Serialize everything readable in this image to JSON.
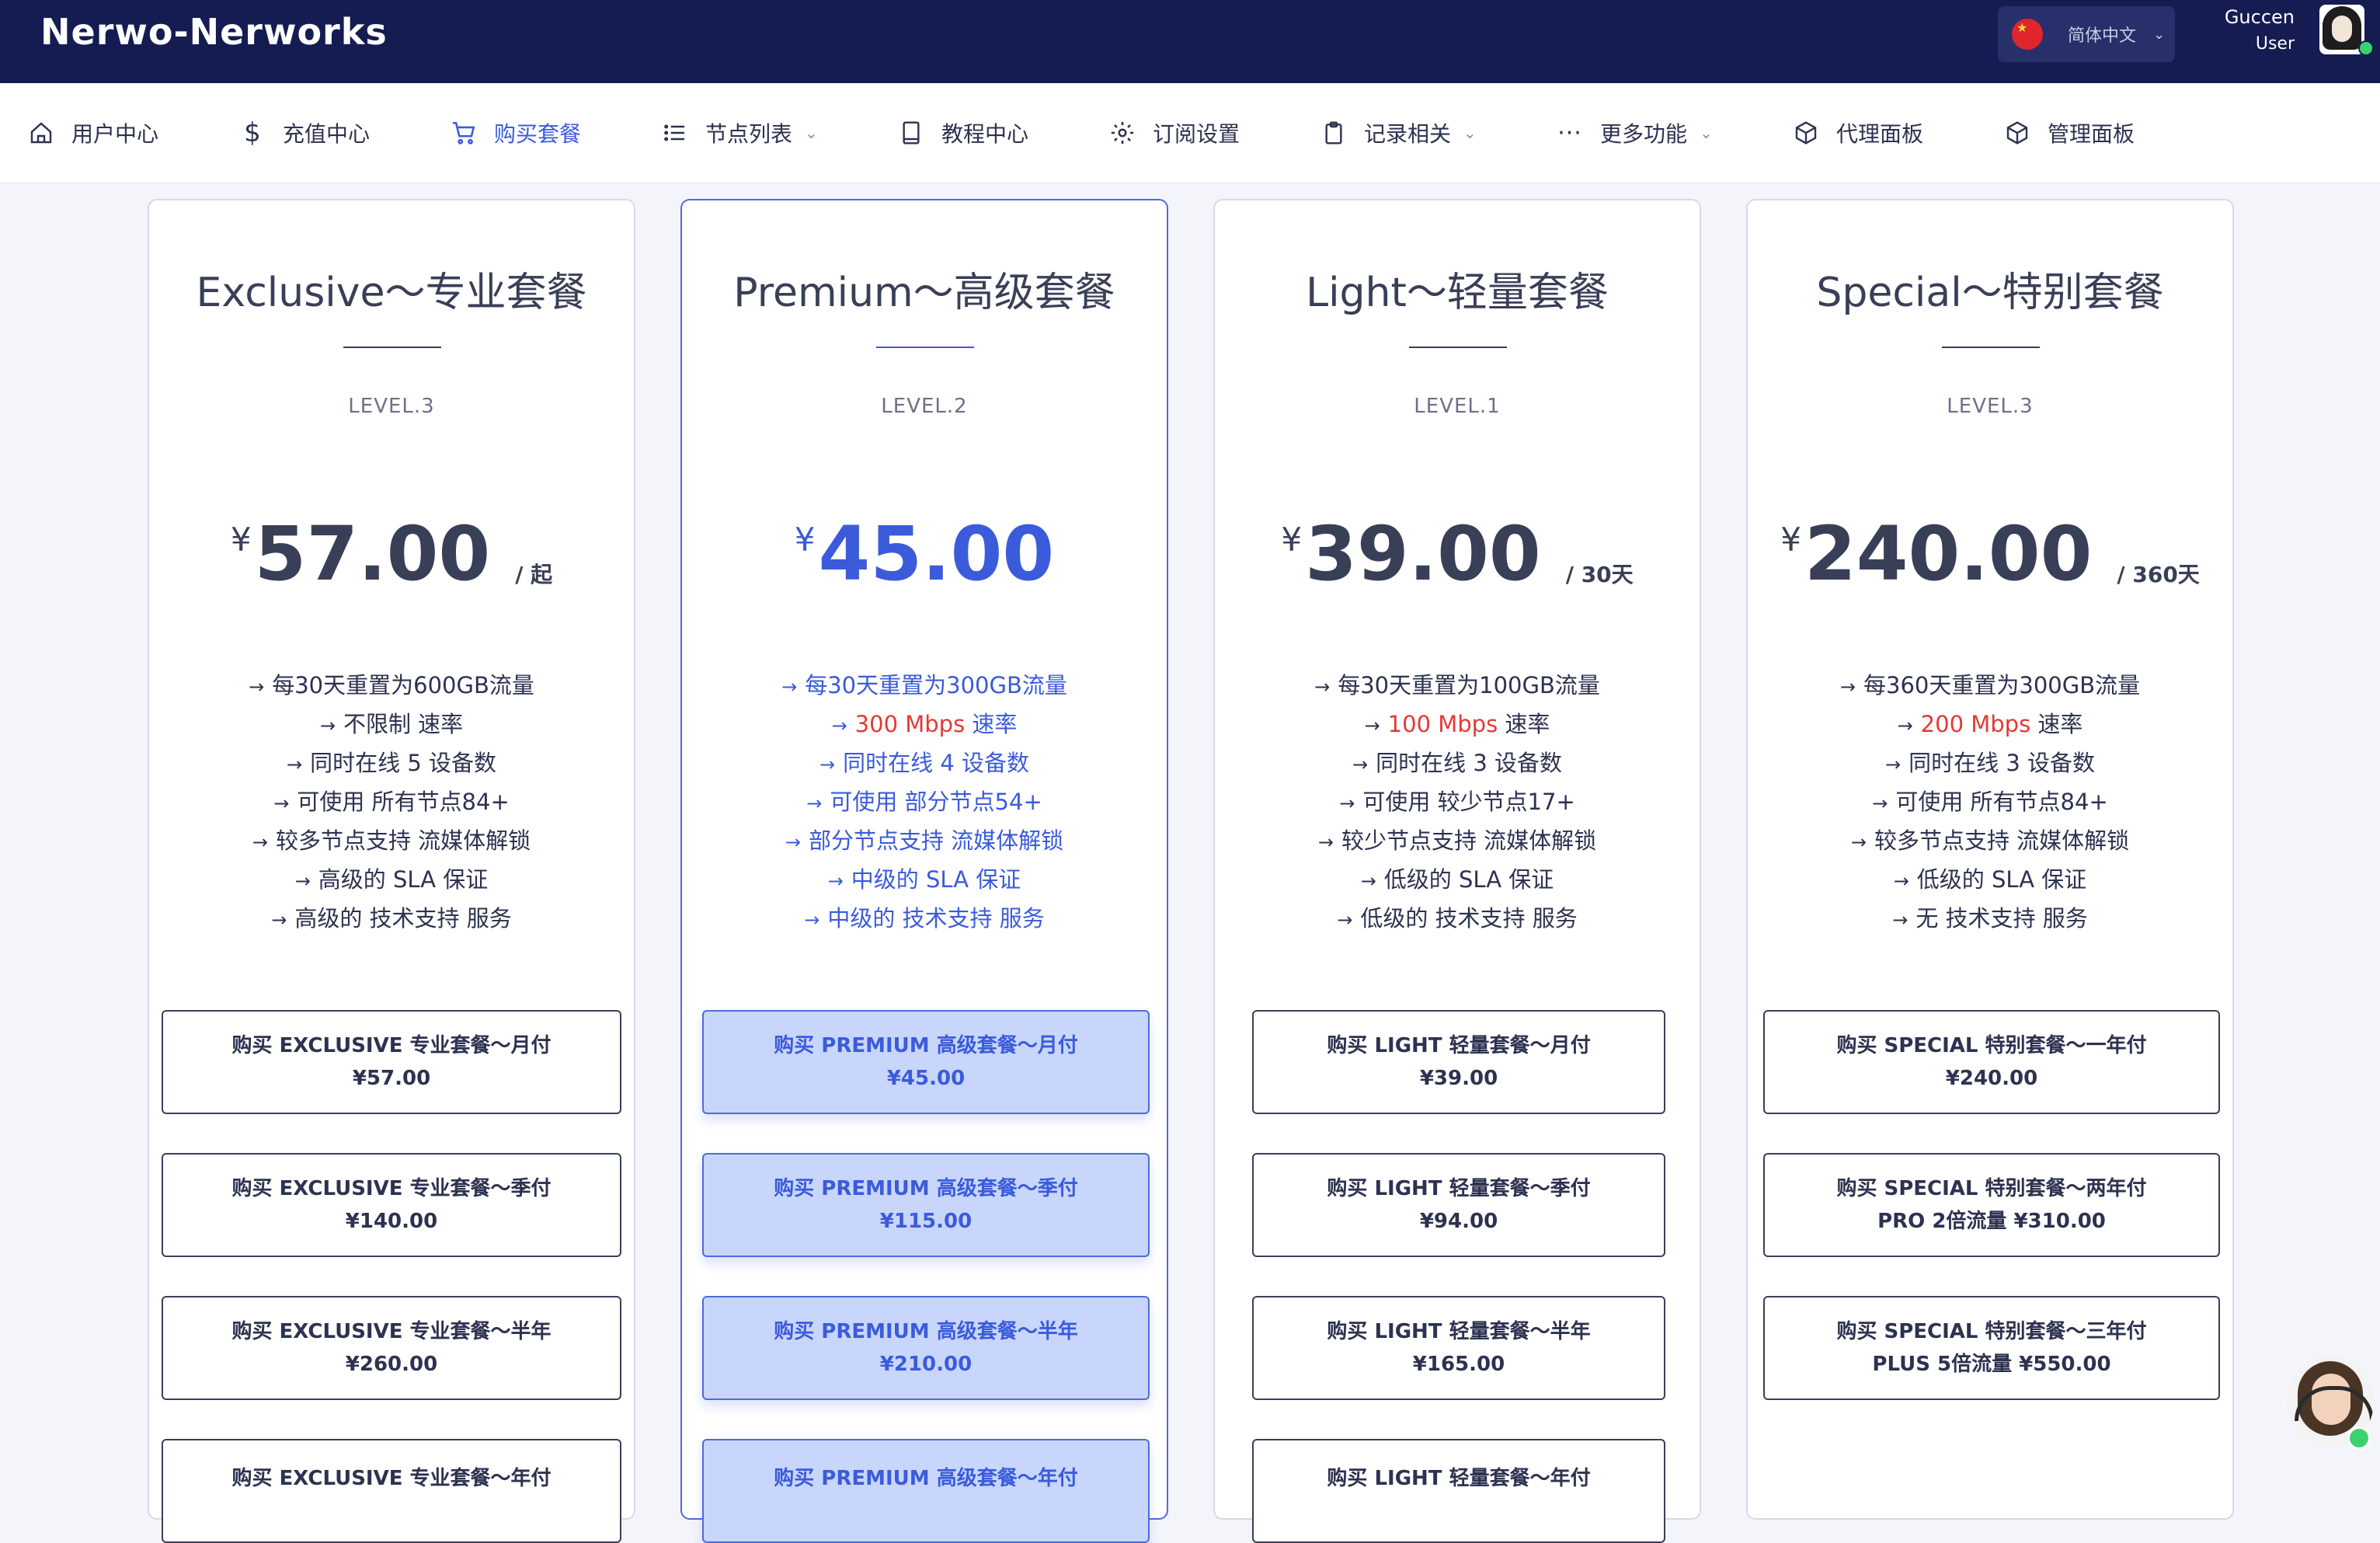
{
  "app": {
    "brand": "Nerwo-Nerworks",
    "language": "简体中文",
    "user_name": "Guccen",
    "user_role": "User"
  },
  "nav": [
    {
      "label": "用户中心",
      "icon": "home-icon",
      "dropdown": false,
      "active": false
    },
    {
      "label": "充值中心",
      "icon": "dollar-icon",
      "dropdown": false,
      "active": false
    },
    {
      "label": "购买套餐",
      "icon": "cart-icon",
      "dropdown": false,
      "active": true
    },
    {
      "label": "节点列表",
      "icon": "list-icon",
      "dropdown": true,
      "active": false
    },
    {
      "label": "教程中心",
      "icon": "book-icon",
      "dropdown": false,
      "active": false
    },
    {
      "label": "订阅设置",
      "icon": "gear-icon",
      "dropdown": false,
      "active": false
    },
    {
      "label": "记录相关",
      "icon": "clipboard-icon",
      "dropdown": true,
      "active": false
    },
    {
      "label": "更多功能",
      "icon": "more-icon",
      "dropdown": true,
      "active": false
    },
    {
      "label": "代理面板",
      "icon": "box-icon",
      "dropdown": false,
      "active": false
    },
    {
      "label": "管理面板",
      "icon": "box-icon",
      "dropdown": false,
      "active": false
    }
  ],
  "colors": {
    "topbar": "#141c52",
    "accent": "#3b5bdb",
    "highlight_red": "#e53935",
    "button_blue_fill": "#c8d6fb"
  },
  "plans": [
    {
      "title": "Exclusive～专业套餐",
      "level": "LEVEL.3",
      "currency": "¥",
      "price": "57.00",
      "period": "/ 起",
      "features": [
        {
          "arrow": "→",
          "pre": "每30天重置为600GB流量",
          "red": "",
          "post": ""
        },
        {
          "arrow": "→",
          "pre": "不限制 速率",
          "red": "",
          "post": ""
        },
        {
          "arrow": "→",
          "pre": "同时在线 5 设备数",
          "red": "",
          "post": ""
        },
        {
          "arrow": "→",
          "pre": "可使用 所有节点84+",
          "red": "",
          "post": ""
        },
        {
          "arrow": "→",
          "pre": "较多节点支持 流媒体解锁",
          "red": "",
          "post": ""
        },
        {
          "arrow": "→",
          "pre": "高级的 SLA 保证",
          "red": "",
          "post": ""
        },
        {
          "arrow": "→",
          "pre": "高级的 技术支持 服务",
          "red": "",
          "post": ""
        }
      ],
      "buttons": [
        {
          "line1": "购买 EXCLUSIVE 专业套餐～月付",
          "line2": "¥57.00"
        },
        {
          "line1": "购买 EXCLUSIVE 专业套餐～季付",
          "line2": "¥140.00"
        },
        {
          "line1": "购买 EXCLUSIVE 专业套餐～半年",
          "line2": "¥260.00"
        },
        {
          "line1": "购买 EXCLUSIVE 专业套餐～年付",
          "line2": ""
        }
      ]
    },
    {
      "title": "Premium～高级套餐",
      "level": "LEVEL.2",
      "currency": "¥",
      "price": "45.00",
      "period": "",
      "features": [
        {
          "arrow": "→",
          "pre": "每30天重置为300GB流量",
          "red": "",
          "post": ""
        },
        {
          "arrow": "→",
          "pre": "",
          "red": "300 Mbps",
          "post": " 速率"
        },
        {
          "arrow": "→",
          "pre": "同时在线 4 设备数",
          "red": "",
          "post": ""
        },
        {
          "arrow": "→",
          "pre": "可使用 部分节点54+",
          "red": "",
          "post": ""
        },
        {
          "arrow": "→",
          "pre": "部分节点支持 流媒体解锁",
          "red": "",
          "post": ""
        },
        {
          "arrow": "→",
          "pre": "中级的 SLA 保证",
          "red": "",
          "post": ""
        },
        {
          "arrow": "→",
          "pre": "中级的 技术支持 服务",
          "red": "",
          "post": ""
        }
      ],
      "buttons": [
        {
          "line1": "购买 PREMIUM 高级套餐～月付",
          "line2": "¥45.00"
        },
        {
          "line1": "购买 PREMIUM 高级套餐～季付",
          "line2": "¥115.00"
        },
        {
          "line1": "购买 PREMIUM 高级套餐～半年",
          "line2": "¥210.00"
        },
        {
          "line1": "购买 PREMIUM 高级套餐～年付",
          "line2": ""
        }
      ]
    },
    {
      "title": "Light～轻量套餐",
      "level": "LEVEL.1",
      "currency": "¥",
      "price": "39.00",
      "period": "/ 30天",
      "features": [
        {
          "arrow": "→",
          "pre": "每30天重置为100GB流量",
          "red": "",
          "post": ""
        },
        {
          "arrow": "→",
          "pre": "",
          "red": "100 Mbps",
          "post": " 速率"
        },
        {
          "arrow": "→",
          "pre": "同时在线 3 设备数",
          "red": "",
          "post": ""
        },
        {
          "arrow": "→",
          "pre": "可使用 较少节点17+",
          "red": "",
          "post": ""
        },
        {
          "arrow": "→",
          "pre": "较少节点支持 流媒体解锁",
          "red": "",
          "post": ""
        },
        {
          "arrow": "→",
          "pre": "低级的 SLA 保证",
          "red": "",
          "post": ""
        },
        {
          "arrow": "→",
          "pre": "低级的 技术支持 服务",
          "red": "",
          "post": ""
        }
      ],
      "buttons": [
        {
          "line1": "购买 LIGHT 轻量套餐～月付",
          "line2": "¥39.00"
        },
        {
          "line1": "购买 LIGHT 轻量套餐～季付",
          "line2": "¥94.00"
        },
        {
          "line1": "购买 LIGHT 轻量套餐～半年",
          "line2": "¥165.00"
        },
        {
          "line1": "购买 LIGHT 轻量套餐～年付",
          "line2": ""
        }
      ]
    },
    {
      "title": "Special～特别套餐",
      "level": "LEVEL.3",
      "currency": "¥",
      "price": "240.00",
      "period": "/ 360天",
      "features": [
        {
          "arrow": "→",
          "pre": "每360天重置为300GB流量",
          "red": "",
          "post": ""
        },
        {
          "arrow": "→",
          "pre": "",
          "red": "200 Mbps",
          "post": " 速率"
        },
        {
          "arrow": "→",
          "pre": "同时在线 3 设备数",
          "red": "",
          "post": ""
        },
        {
          "arrow": "→",
          "pre": "可使用 所有节点84+",
          "red": "",
          "post": ""
        },
        {
          "arrow": "→",
          "pre": "较多节点支持 流媒体解锁",
          "red": "",
          "post": ""
        },
        {
          "arrow": "→",
          "pre": "低级的 SLA 保证",
          "red": "",
          "post": ""
        },
        {
          "arrow": "→",
          "pre": "无 技术支持 服务",
          "red": "",
          "post": ""
        }
      ],
      "buttons": [
        {
          "line1": "购买 SPECIAL 特别套餐～一年付",
          "line2": "¥240.00"
        },
        {
          "line1": "购买 SPECIAL 特别套餐～两年付",
          "line2": "PRO 2倍流量 ¥310.00"
        },
        {
          "line1": "购买 SPECIAL 特别套餐～三年付",
          "line2": "PLUS 5倍流量 ¥550.00"
        }
      ]
    }
  ]
}
